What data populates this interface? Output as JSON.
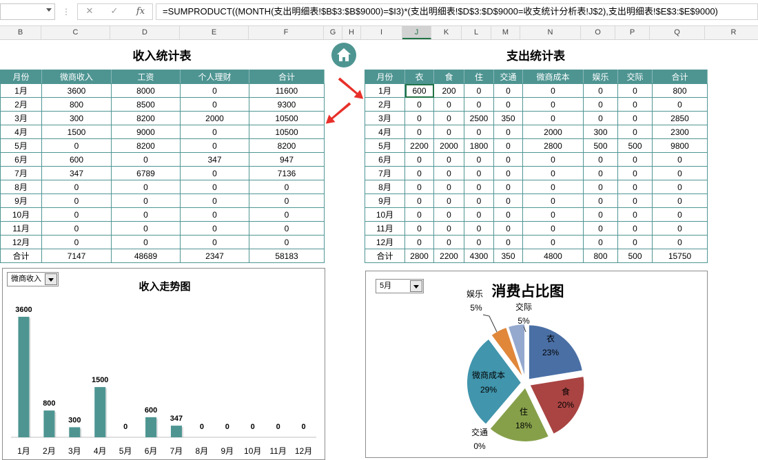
{
  "formula_bar": {
    "formula": "=SUMPRODUCT((MONTH(支出明细表!$B$3:$B$9000)=$I3)*(支出明细表!$D$3:$D$9000=收支统计分析表!J$2),支出明细表!$E$3:$E$9000)",
    "fx_label": "fx"
  },
  "columns": [
    "B",
    "C",
    "D",
    "E",
    "F",
    "G",
    "H",
    "I",
    "J",
    "K",
    "L",
    "M",
    "N",
    "O",
    "P",
    "Q",
    "R"
  ],
  "income": {
    "title": "收入统计表",
    "headers": [
      "月份",
      "微商收入",
      "工资",
      "个人理财",
      "合计"
    ],
    "rows": [
      [
        "1月",
        "3600",
        "8000",
        "0",
        "11600"
      ],
      [
        "2月",
        "800",
        "8500",
        "0",
        "9300"
      ],
      [
        "3月",
        "300",
        "8200",
        "2000",
        "10500"
      ],
      [
        "4月",
        "1500",
        "9000",
        "0",
        "10500"
      ],
      [
        "5月",
        "0",
        "8200",
        "0",
        "8200"
      ],
      [
        "6月",
        "600",
        "0",
        "347",
        "947"
      ],
      [
        "7月",
        "347",
        "6789",
        "0",
        "7136"
      ],
      [
        "8月",
        "0",
        "0",
        "0",
        "0"
      ],
      [
        "9月",
        "0",
        "0",
        "0",
        "0"
      ],
      [
        "10月",
        "0",
        "0",
        "0",
        "0"
      ],
      [
        "11月",
        "0",
        "0",
        "0",
        "0"
      ],
      [
        "12月",
        "0",
        "0",
        "0",
        "0"
      ],
      [
        "合计",
        "7147",
        "48689",
        "2347",
        "58183"
      ]
    ]
  },
  "expense": {
    "title": "支出统计表",
    "headers": [
      "月份",
      "衣",
      "食",
      "住",
      "交通",
      "微商成本",
      "娱乐",
      "交际",
      "合计"
    ],
    "rows": [
      [
        "1月",
        "600",
        "200",
        "0",
        "0",
        "0",
        "0",
        "0",
        "800"
      ],
      [
        "2月",
        "0",
        "0",
        "0",
        "0",
        "0",
        "0",
        "0",
        "0"
      ],
      [
        "3月",
        "0",
        "0",
        "2500",
        "350",
        "0",
        "0",
        "0",
        "2850"
      ],
      [
        "4月",
        "0",
        "0",
        "0",
        "0",
        "2000",
        "300",
        "0",
        "2300"
      ],
      [
        "5月",
        "2200",
        "2000",
        "1800",
        "0",
        "2800",
        "500",
        "500",
        "9800"
      ],
      [
        "6月",
        "0",
        "0",
        "0",
        "0",
        "0",
        "0",
        "0",
        "0"
      ],
      [
        "7月",
        "0",
        "0",
        "0",
        "0",
        "0",
        "0",
        "0",
        "0"
      ],
      [
        "8月",
        "0",
        "0",
        "0",
        "0",
        "0",
        "0",
        "0",
        "0"
      ],
      [
        "9月",
        "0",
        "0",
        "0",
        "0",
        "0",
        "0",
        "0",
        "0"
      ],
      [
        "10月",
        "0",
        "0",
        "0",
        "0",
        "0",
        "0",
        "0",
        "0"
      ],
      [
        "11月",
        "0",
        "0",
        "0",
        "0",
        "0",
        "0",
        "0",
        "0"
      ],
      [
        "12月",
        "0",
        "0",
        "0",
        "0",
        "0",
        "0",
        "0",
        "0"
      ],
      [
        "合计",
        "2800",
        "2200",
        "4300",
        "350",
        "4800",
        "800",
        "500",
        "15750"
      ]
    ]
  },
  "income_chart": {
    "dropdown_value": "微商收入",
    "title": "收入走势图"
  },
  "pie_chart": {
    "dropdown_value": "5月",
    "title": "消费占比图"
  },
  "chart_data": [
    {
      "type": "bar",
      "title": "收入走势图",
      "categories": [
        "1月",
        "2月",
        "3月",
        "4月",
        "5月",
        "6月",
        "7月",
        "8月",
        "9月",
        "10月",
        "11月",
        "12月"
      ],
      "values": [
        3600,
        800,
        300,
        1500,
        0,
        600,
        347,
        0,
        0,
        0,
        0,
        0
      ],
      "data_labels": [
        "3600",
        "800",
        "300",
        "1500",
        "0",
        "600",
        "347",
        "0",
        "0",
        "0",
        "0",
        "0"
      ],
      "color": "#4e9592"
    },
    {
      "type": "pie",
      "title": "消费占比图",
      "labels": [
        "衣",
        "食",
        "住",
        "交通",
        "微商成本",
        "娱乐",
        "交际"
      ],
      "values": [
        2200,
        2000,
        1800,
        0,
        2800,
        500,
        500
      ],
      "percent_labels": [
        "23%",
        "20%",
        "18%",
        "0%",
        "29%",
        "5%",
        "5%"
      ],
      "colors": [
        "#4a6fa5",
        "#a94442",
        "#86a04a",
        "#6e4f8f",
        "#4195ac",
        "#e0873a",
        "#95a9cf"
      ]
    }
  ],
  "colors": {
    "header_teal": "#4e9592",
    "arrow_red": "#e8302a",
    "excel_green": "#217346"
  },
  "icons": [
    "close-icon",
    "check-icon",
    "home-icon",
    "dropdown-arrow-icon"
  ]
}
